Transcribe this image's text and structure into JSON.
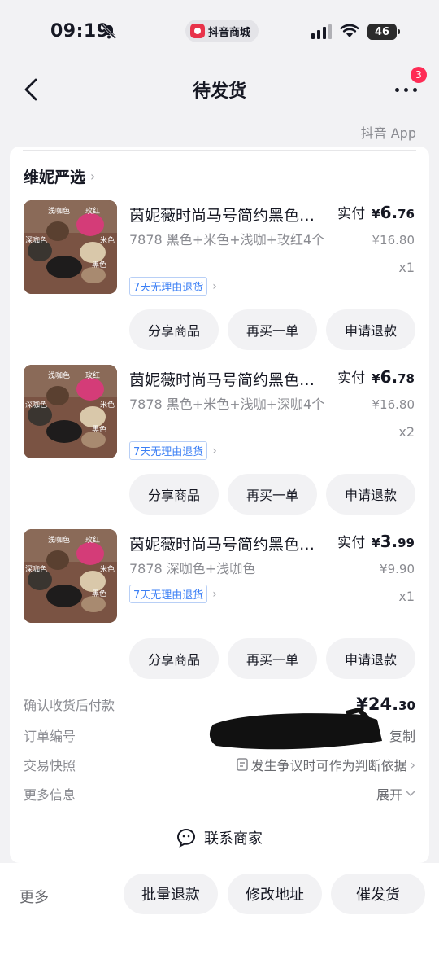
{
  "status_bar": {
    "time": "09:19",
    "app_name": "抖音商城",
    "battery": "46"
  },
  "nav": {
    "title": "待发货",
    "badge_count": "3"
  },
  "source_label": "抖音 App",
  "shop": {
    "name": "维妮严选"
  },
  "items": [
    {
      "title": "茵妮薇时尚马号简约黑色…",
      "spec": "7878 黑色+米色+浅咖+玫红4个",
      "return_tag": "7天无理由退货",
      "paid_label": "实付",
      "paid_yen": "¥",
      "paid_int": "6.",
      "paid_dec": "76",
      "original": "¥16.80",
      "qty": "x1",
      "buttons": [
        "分享商品",
        "再买一单",
        "申请退款"
      ]
    },
    {
      "title": "茵妮薇时尚马号简约黑色…",
      "spec": "7878 黑色+米色+浅咖+深咖4个",
      "return_tag": "7天无理由退货",
      "paid_label": "实付",
      "paid_yen": "¥",
      "paid_int": "6.",
      "paid_dec": "78",
      "original": "¥16.80",
      "qty": "x2",
      "buttons": [
        "分享商品",
        "再买一单",
        "申请退款"
      ]
    },
    {
      "title": "茵妮薇时尚马号简约黑色…",
      "spec": "7878 深咖色+浅咖色",
      "return_tag": "7天无理由退货",
      "paid_label": "实付",
      "paid_yen": "¥",
      "paid_int": "3.",
      "paid_dec": "99",
      "original": "¥9.90",
      "qty": "x1",
      "buttons": [
        "分享商品",
        "再买一单",
        "申请退款"
      ]
    }
  ],
  "thumb_labels": [
    "浅咖色",
    "玫红",
    "深咖色",
    "米色",
    "黑色"
  ],
  "info": {
    "pay_label": "确认收货后付款",
    "total_int": "¥24.",
    "total_dec": "30",
    "order_label": "订单编号",
    "copy": "复制",
    "snapshot_label": "交易快照",
    "snapshot_value": "发生争议时可作为判断依据",
    "more_label": "更多信息",
    "expand": "展开"
  },
  "contact": "联系商家",
  "bottom": {
    "more": "更多",
    "btn1": "批量退款",
    "btn2": "修改地址",
    "btn3": "催发货"
  },
  "colors": {
    "accent_red": "#fe2c55",
    "tag_blue": "#3b7ff5",
    "text_gray": "#8a8b91"
  }
}
